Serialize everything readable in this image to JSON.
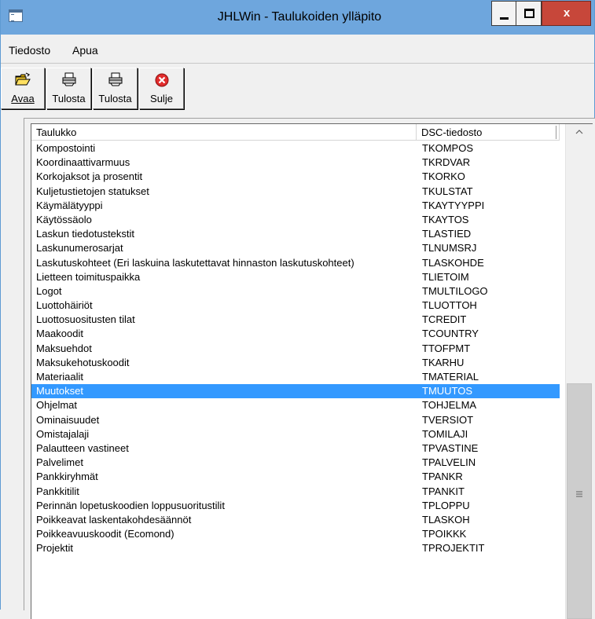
{
  "window": {
    "title": "JHLWin - Taulukoiden ylläpito",
    "minimize_glyph": "",
    "close_glyph": "x"
  },
  "menu": [
    {
      "label": "Tiedosto"
    },
    {
      "label": "Apua"
    }
  ],
  "toolbar": {
    "open": {
      "label": "Avaa",
      "icon": "open-folder-icon"
    },
    "print1": {
      "label": "Tulosta",
      "icon": "printer-icon"
    },
    "print2": {
      "label": "Tulosta",
      "icon": "printer-icon"
    },
    "close": {
      "label": "Sulje",
      "icon": "red-close-icon"
    }
  },
  "table": {
    "columns": [
      "Taulukko",
      "DSC-tiedosto"
    ],
    "selected_index": 18,
    "rows": [
      [
        "Kompostointi",
        "TKOMPOS"
      ],
      [
        "Koordinaattivarmuus",
        "TKRDVAR"
      ],
      [
        "Korkojaksot ja prosentit",
        "TKORKO"
      ],
      [
        "Kuljetustietojen statukset",
        "TKULSTAT"
      ],
      [
        "Käymälätyyppi",
        "TKAYTYYPPI"
      ],
      [
        "Käytössäolo",
        "TKAYTOS"
      ],
      [
        "Laskun tiedotustekstit",
        "TLASTIED"
      ],
      [
        "Laskunumerosarjat",
        "TLNUMSRJ"
      ],
      [
        "Laskutuskohteet (Eri laskuina laskutettavat hinnaston laskutuskohteet)",
        "TLASKOHDE"
      ],
      [
        "Lietteen toimituspaikka",
        "TLIETOIM"
      ],
      [
        "Logot",
        "TMULTILOGO"
      ],
      [
        "Luottohäiriöt",
        "TLUOTTOH"
      ],
      [
        "Luottosuositusten tilat",
        "TCREDIT"
      ],
      [
        "Maakoodit",
        "TCOUNTRY"
      ],
      [
        "Maksuehdot",
        "TTOFPMT"
      ],
      [
        "Maksukehotuskoodit",
        "TKARHU"
      ],
      [
        "Materiaalit",
        "TMATERIAL"
      ],
      [
        "Muutokset",
        "TMUUTOS"
      ],
      [
        "Ohjelmat",
        "TOHJELMA"
      ],
      [
        "Ominaisuudet",
        "TVERSIOT"
      ],
      [
        "Omistajalaji",
        "TOMILAJI"
      ],
      [
        "Palautteen vastineet",
        "TPVASTINE"
      ],
      [
        "Palvelimet",
        "TPALVELIN"
      ],
      [
        "Pankkiryhmät",
        "TPANKR"
      ],
      [
        "Pankkitilit",
        "TPANKIT"
      ],
      [
        "Perinnän lopetuskoodien loppusuoritustilit",
        "TPLOPPU"
      ],
      [
        "Poikkeavat laskentakohdesäännöt",
        "TLASKOH"
      ],
      [
        "Poikkeavuuskoodit (Ecomond)",
        "TPOIKKK"
      ],
      [
        "Projektit",
        "TPROJEKTIT"
      ]
    ]
  },
  "colors": {
    "titlebar": "#6ea6dd",
    "selection": "#3399ff",
    "close_button": "#c7473a"
  }
}
